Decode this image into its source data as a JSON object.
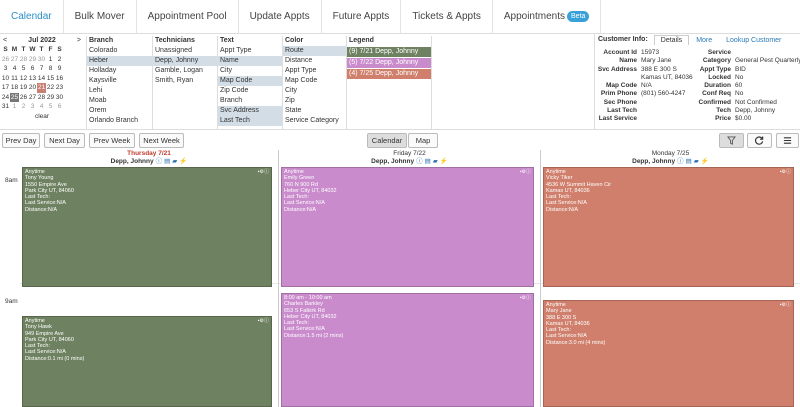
{
  "tabs": [
    "Calendar",
    "Bulk Mover",
    "Appointment Pool",
    "Update Appts",
    "Future Appts",
    "Tickets & Appts",
    "Appointments"
  ],
  "beta_label": "Beta",
  "mini_cal": {
    "prev": "<",
    "next": ">",
    "month": "Jul 2022",
    "days_hdr": [
      "S",
      "M",
      "T",
      "W",
      "T",
      "F",
      "S"
    ],
    "weeks": [
      [
        "26",
        "27",
        "28",
        "29",
        "30",
        "1",
        "2"
      ],
      [
        "3",
        "4",
        "5",
        "6",
        "7",
        "8",
        "9"
      ],
      [
        "10",
        "11",
        "12",
        "13",
        "14",
        "15",
        "16"
      ],
      [
        "17",
        "18",
        "19",
        "20",
        "21",
        "22",
        "23"
      ],
      [
        "24",
        "25",
        "26",
        "27",
        "28",
        "29",
        "30"
      ],
      [
        "31",
        "1",
        "2",
        "3",
        "4",
        "5",
        "6"
      ]
    ],
    "clear": "clear"
  },
  "filters": {
    "branch": {
      "title": "Branch",
      "items": [
        "Colorado",
        "Heber",
        "Holladay",
        "Kaysville",
        "Lehi",
        "Moab",
        "Orem",
        "Orlando Branch"
      ]
    },
    "technicians": {
      "title": "Technicians",
      "items": [
        "Unassigned",
        "Depp, Johnny",
        "Gamble, Logan",
        "Smith, Ryan"
      ]
    },
    "text": {
      "title": "Text",
      "items": [
        "Appt Type",
        "Name",
        "City",
        "Map Code",
        "Zip Code",
        "Branch",
        "Svc Address",
        "Last Tech"
      ]
    },
    "color": {
      "title": "Color",
      "items": [
        "Route",
        "Distance",
        "Appt Type",
        "Map Code",
        "City",
        "Zip",
        "State",
        "Service Category"
      ]
    },
    "legend": {
      "title": "Legend",
      "items": [
        "(9) 7/21 Depp, Johnny",
        "(5) 7/22 Depp, Johnny",
        "(4) 7/25 Depp, Johnny"
      ]
    }
  },
  "customer": {
    "title": "Customer Info:",
    "tabs": [
      "Details",
      "More",
      "Lookup Customer"
    ],
    "left": [
      [
        "Account Id",
        "15973"
      ],
      [
        "Name",
        "Mary Jane"
      ],
      [
        "Svc Address",
        "388 E 300 S"
      ],
      [
        "",
        "Kamas UT, 84036"
      ],
      [
        "Map Code",
        "N/A"
      ],
      [
        "Prim Phone",
        "(801) 560-4247"
      ],
      [
        "Sec Phone",
        ""
      ],
      [
        "Last Tech",
        ""
      ],
      [
        "Last Service",
        ""
      ]
    ],
    "right": [
      [
        "Service",
        ""
      ],
      [
        "Category",
        "General Pest Quarterly"
      ],
      [
        "Appt Type",
        "BID"
      ],
      [
        "Locked",
        "No"
      ],
      [
        "Duration",
        "60"
      ],
      [
        "Conf Req",
        "No"
      ],
      [
        "Confirmed",
        "Not Confirmed"
      ],
      [
        "Tech",
        "Depp, Johnny"
      ],
      [
        "Price",
        "$0.00"
      ]
    ]
  },
  "toolbar": {
    "prev_day": "Prev Day",
    "next_day": "Next Day",
    "prev_week": "Prev Week",
    "next_week": "Next Week",
    "calendar": "Calendar",
    "map": "Map"
  },
  "time_labels": [
    "8am",
    "9am"
  ],
  "days": [
    {
      "date": "Thursday 7/21",
      "tech": "Depp, Johnny",
      "color": "#6e8160",
      "appts": [
        {
          "lines": [
            "Anytime",
            "Tony Young",
            "1550 Empire Ave",
            "Park City UT, 84060",
            "Last Tech:",
            "Last Service:N/A",
            "Distance:N/A"
          ]
        },
        {
          "lines": [
            "Anytime",
            "Tony Hawk",
            "949 Empire Ave",
            "Park City UT, 84060",
            "Last Tech:",
            "Last Service:N/A",
            "Distance:0.1 mi (0 mins)"
          ]
        }
      ]
    },
    {
      "date": "Friday 7/22",
      "tech": "Depp, Johnny",
      "color": "#c98bcc",
      "appts": [
        {
          "lines": [
            "Anytime",
            "Emily Green",
            "760 N 900 Rd",
            "Heber City UT, 84032",
            "Last Tech:",
            "Last Service:N/A",
            "Distance:N/A"
          ]
        },
        {
          "lines": [
            "8:00 am - 10:00 am",
            "Charles Barkley",
            "653 S Falkirk Rd",
            "Heber City UT, 84032",
            "Last Tech:",
            "Last Service:N/A",
            "Distance:1.5 mi (2 mins)"
          ]
        }
      ]
    },
    {
      "date": "Monday 7/25",
      "tech": "Depp, Johnny",
      "color": "#cf7f6b",
      "appts": [
        {
          "lines": [
            "Anytime",
            "Vicky Tiker",
            "4536 W Summit Haven Cir",
            "Kamas UT, 84036",
            "Last Tech:",
            "Last Service:N/A",
            "Distance:N/A"
          ]
        },
        {
          "lines": [
            "Anytime",
            "Mary Jane",
            "388 E 300 S",
            "Kamas UT, 84036",
            "Last Tech:",
            "Last Service:N/A",
            "Distance:3.0 mi (4 mins)"
          ]
        }
      ]
    }
  ],
  "colors": {
    "accent": "#2a8fc9",
    "green": "#6e8160",
    "purple": "#c98bcc",
    "salmon": "#cf7f6b"
  }
}
